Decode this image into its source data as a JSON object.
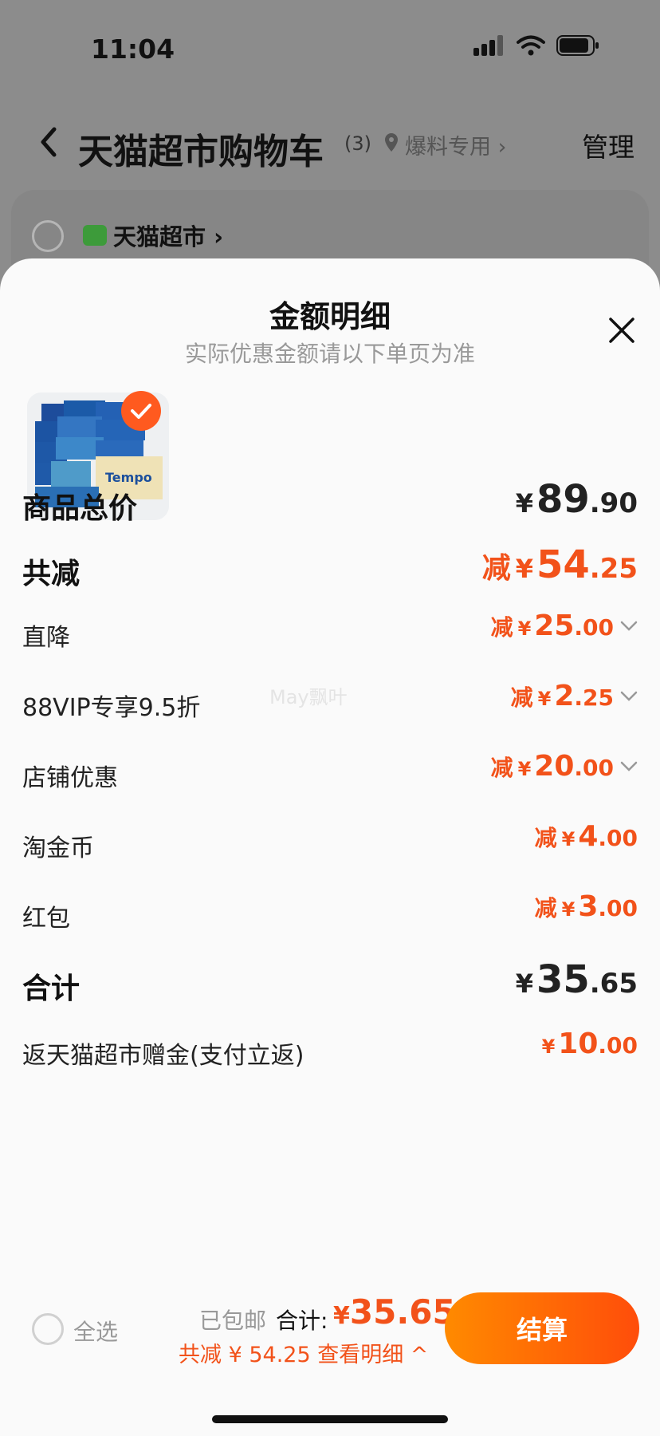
{
  "status_bar": {
    "time": "11:04"
  },
  "nav": {
    "title": "天猫超市购物车",
    "count": "(3)",
    "location": "爆料专用",
    "manage": "管理"
  },
  "store": {
    "name": "天猫超市"
  },
  "sheet": {
    "title": "金额明细",
    "subtitle": "实际优惠金额请以下单页为准",
    "watermark": "May飘叶",
    "rows": [
      {
        "label": "商品总价",
        "prefix": "",
        "yen": "¥",
        "int": "89",
        "dec": ".90"
      },
      {
        "label": "共减",
        "prefix": "减",
        "yen": "¥",
        "int": "54",
        "dec": ".25"
      },
      {
        "label": "直降",
        "prefix": "减",
        "yen": "¥",
        "int": "25",
        "dec": ".00"
      },
      {
        "label": "88VIP专享9.5折",
        "prefix": "减",
        "yen": "¥",
        "int": "2",
        "dec": ".25"
      },
      {
        "label": "店铺优惠",
        "prefix": "减",
        "yen": "¥",
        "int": "20",
        "dec": ".00"
      },
      {
        "label": "淘金币",
        "prefix": "减",
        "yen": "¥",
        "int": "4",
        "dec": ".00"
      },
      {
        "label": "红包",
        "prefix": "减",
        "yen": "¥",
        "int": "3",
        "dec": ".00"
      },
      {
        "label": "合计",
        "prefix": "",
        "yen": "¥",
        "int": "35",
        "dec": ".65"
      },
      {
        "label": "返天猫超市赠金(支付立返)",
        "prefix": "",
        "yen": "¥",
        "int": "10",
        "dec": ".00"
      }
    ]
  },
  "bottom": {
    "select_all": "全选",
    "shipping": "已包邮",
    "total_label": "合计:",
    "total_yen": "¥",
    "total_value": "35.65",
    "discount_line": "共减 ¥ 54.25  查看明细 ^",
    "checkout": "结算"
  },
  "colors": {
    "accent": "#f2521a",
    "button_start": "#ff8a00",
    "button_end": "#ff4d0a"
  }
}
